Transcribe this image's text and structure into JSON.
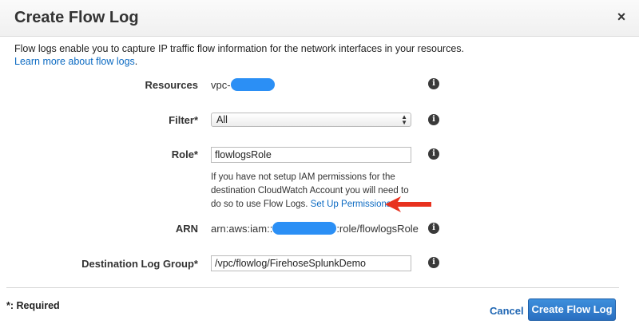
{
  "dialog": {
    "title": "Create Flow Log",
    "close_icon": "×"
  },
  "intro": {
    "text": "Flow logs enable you to capture IP traffic flow information for the network interfaces in your resources.",
    "learn_more": "Learn more about flow logs",
    "after_link": "."
  },
  "fields": {
    "resources": {
      "label": "Resources",
      "value_prefix": "vpc-"
    },
    "filter": {
      "label": "Filter*",
      "selected": "All"
    },
    "role": {
      "label": "Role*",
      "value": "flowlogsRole",
      "help": "If you have not setup IAM permissions for the destination CloudWatch Account you will need to do so to use Flow Logs.",
      "help_link": "Set Up Permissions"
    },
    "arn": {
      "label": "ARN",
      "prefix": "arn:aws:iam::",
      "suffix": ":role/flowlogsRole"
    },
    "destination": {
      "label": "Destination Log Group*",
      "value": "/vpc/flowlog/FirehoseSplunkDemo"
    }
  },
  "footer": {
    "required_note": "*: Required",
    "cancel_label": "Cancel",
    "create_label": "Create Flow Log"
  },
  "icons": {
    "info": "i",
    "select_arrows": "▲▼"
  },
  "colors": {
    "link": "#0b6ac2",
    "primary_button": "#2a6fc0",
    "redaction": "#2b8ff5",
    "annotation_arrow": "#e8321f"
  }
}
